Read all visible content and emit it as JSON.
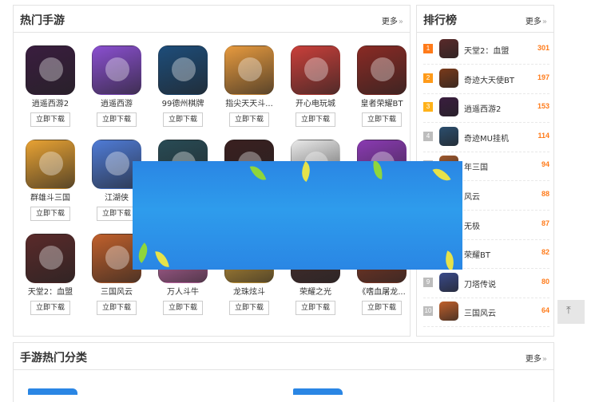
{
  "hot_games": {
    "title": "热门手游",
    "more_label": "更多",
    "download_label": "立即下载",
    "games": [
      {
        "name": "逍遥西游2",
        "color": "#3a1d3f"
      },
      {
        "name": "逍遥西游",
        "color": "#8a4fd0"
      },
      {
        "name": "99德州棋牌",
        "color": "#1d4d7a"
      },
      {
        "name": "指尖天天斗...",
        "color": "#e79a3e"
      },
      {
        "name": "开心电玩城",
        "color": "#c93f3a"
      },
      {
        "name": "皇者荣耀BT",
        "color": "#8a2a24"
      },
      {
        "name": "群雄斗三国",
        "color": "#e8a233"
      },
      {
        "name": "江湖侠",
        "color": "#4f7bd6"
      },
      {
        "name": "",
        "color": "#284b55"
      },
      {
        "name": "",
        "color": "#3a2020"
      },
      {
        "name": "",
        "color": "#e9e9e9"
      },
      {
        "name": "",
        "color": "#8a3ab2"
      },
      {
        "name": "天堂2：血盟",
        "color": "#5a2a2a"
      },
      {
        "name": "三国风云",
        "color": "#c0602c"
      },
      {
        "name": "万人斗牛",
        "color": "#d16fb3"
      },
      {
        "name": "龙珠炫斗",
        "color": "#d3a13a"
      },
      {
        "name": "荣耀之光",
        "color": "#4b2f2f"
      },
      {
        "name": "《嗜血屠龙...",
        "color": "#8a3a26"
      }
    ]
  },
  "ranking": {
    "title": "排行榜",
    "more_label": "更多",
    "items": [
      {
        "rank": "1",
        "name": "天堂2：血盟",
        "score": "301",
        "rank_color": "#ff7b1a",
        "icon_color": "#5a2a2a"
      },
      {
        "rank": "2",
        "name": "奇迹大天使BT",
        "score": "197",
        "rank_color": "#ff9b1a",
        "icon_color": "#7a3a1a"
      },
      {
        "rank": "3",
        "name": "逍遥西游2",
        "score": "153",
        "rank_color": "#ffb21a",
        "icon_color": "#3a1d3f"
      },
      {
        "rank": "4",
        "name": "奇迹MU挂机",
        "score": "114",
        "rank_color": "#bdbdbd",
        "icon_color": "#2b4e6e"
      },
      {
        "rank": "5",
        "name": "年三国",
        "score": "94",
        "rank_color": "#bdbdbd",
        "icon_color": "#a0582c"
      },
      {
        "rank": "6",
        "name": "风云",
        "score": "88",
        "rank_color": "#bdbdbd",
        "icon_color": "#c0602c"
      },
      {
        "rank": "7",
        "name": "无极",
        "score": "87",
        "rank_color": "#bdbdbd",
        "icon_color": "#6a3a7a"
      },
      {
        "rank": "8",
        "name": "荣耀BT",
        "score": "82",
        "rank_color": "#bdbdbd",
        "icon_color": "#8a2a24"
      },
      {
        "rank": "9",
        "name": "刀塔传说",
        "score": "80",
        "rank_color": "#bdbdbd",
        "icon_color": "#3a4a8a"
      },
      {
        "rank": "10",
        "name": "三国风云",
        "score": "64",
        "rank_color": "#bdbdbd",
        "icon_color": "#c0602c"
      }
    ]
  },
  "categories": {
    "title": "手游热门分类",
    "more_label": "更多"
  },
  "more_chevron": "»",
  "back_to_top_glyph": "⤒"
}
